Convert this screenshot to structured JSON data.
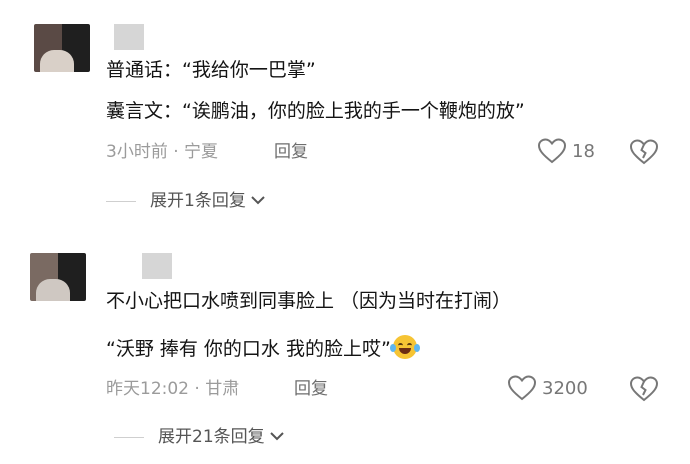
{
  "comments": [
    {
      "lines": [
        "普通话：“我给你一巴掌”",
        "囊言文：“诶鹏油，你的脸上我的手一个鞭炮的放”"
      ],
      "time": "3小时前",
      "location": "宁夏",
      "reply_label": "回复",
      "likes": "18",
      "expand_label": "展开1条回复"
    },
    {
      "lines": [
        "不小心把口水喷到同事脸上 （因为当时在打闹）",
        "“沃野 捧有 你的口水 我的脸上哎”"
      ],
      "time": "昨天12:02",
      "location": "甘肃",
      "reply_label": "回复",
      "likes": "3200",
      "expand_label": "展开21条回复"
    }
  ],
  "meta_separator": "·",
  "icons": {
    "like": "heart-icon",
    "dislike": "broken-heart-icon",
    "expand": "chevron-down-icon",
    "emoji": "laughing-crying-emoji"
  },
  "colors": {
    "text": "#141414",
    "meta": "#9b9b9b",
    "icon": "#777777"
  }
}
